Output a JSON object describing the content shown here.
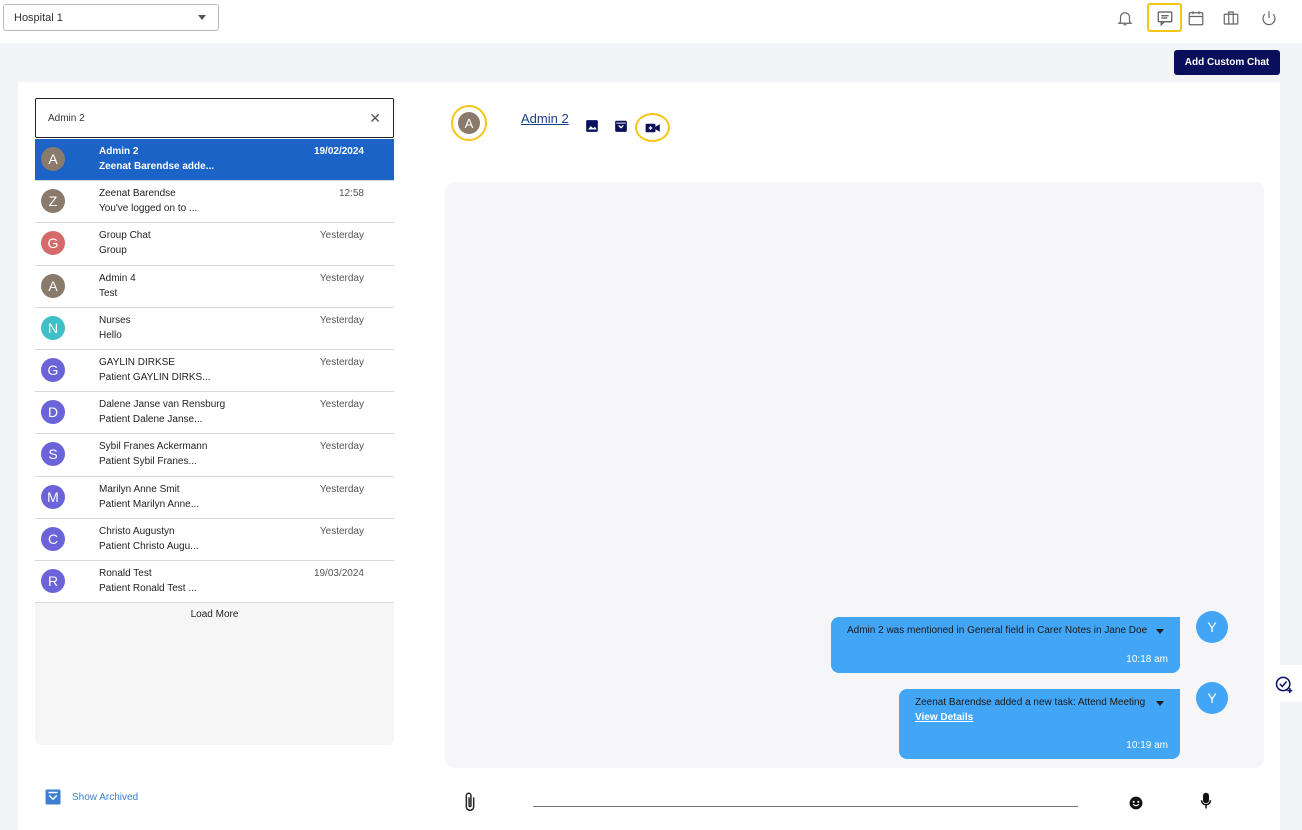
{
  "topbar": {
    "hospital_select": "Hospital 1",
    "icons": [
      "bell-icon",
      "chat-icon",
      "calendar-icon",
      "briefcase-icon",
      "power-icon"
    ]
  },
  "toolbar": {
    "add_custom_chat": "Add Custom Chat"
  },
  "search": {
    "value": "Admin 2"
  },
  "chats": [
    {
      "initial": "A",
      "name": "Admin 2",
      "preview": "Zeenat Barendse adde...",
      "time": "19/02/2024",
      "color": "#8a7a6c",
      "active": true
    },
    {
      "initial": "Z",
      "name": "Zeenat Barendse",
      "preview": "You've logged on to ...",
      "time": "12:58",
      "color": "#8a7a6c"
    },
    {
      "initial": "G",
      "name": "Group Chat",
      "preview": "Group",
      "time": "Yesterday",
      "color": "#d46a6a"
    },
    {
      "initial": "A",
      "name": "Admin 4",
      "preview": "Test",
      "time": "Yesterday",
      "color": "#8a7a6c"
    },
    {
      "initial": "N",
      "name": "Nurses",
      "preview": "Hello",
      "time": "Yesterday",
      "color": "#3fbfc6"
    },
    {
      "initial": "G",
      "name": "GAYLIN DIRKSE",
      "preview": "Patient GAYLIN DIRKS...",
      "time": "Yesterday",
      "color": "#6b63d8"
    },
    {
      "initial": "D",
      "name": "Dalene Janse van Rensburg",
      "preview": "Patient Dalene Janse...",
      "time": "Yesterday",
      "color": "#6b63d8"
    },
    {
      "initial": "S",
      "name": "Sybil Franes Ackermann",
      "preview": "Patient Sybil Franes...",
      "time": "Yesterday",
      "color": "#6b63d8"
    },
    {
      "initial": "M",
      "name": "Marilyn Anne Smit",
      "preview": "Patient Marilyn Anne...",
      "time": "Yesterday",
      "color": "#6b63d8"
    },
    {
      "initial": "C",
      "name": "Christo Augustyn",
      "preview": "Patient Christo Augu...",
      "time": "Yesterday",
      "color": "#6b63d8"
    },
    {
      "initial": "R",
      "name": "Ronald Test",
      "preview": "Patient Ronald Test ...",
      "time": "19/03/2024",
      "color": "#6b63d8"
    }
  ],
  "load_more": "Load More",
  "show_archived": "Show Archived",
  "conversation": {
    "avatar_initial": "A",
    "title": "Admin 2",
    "header_icons": [
      "image-icon",
      "archive-icon",
      "video-call-icon"
    ],
    "messages": [
      {
        "text": "Admin 2 was mentioned in General field in Carer Notes in Jane Doe",
        "time": "10:18 am",
        "avatar": "Y"
      },
      {
        "text": "Zeenat Barendse added a new task: Attend Meeting",
        "link": "View Details",
        "time": "10:19 am",
        "avatar": "Y"
      }
    ]
  },
  "colors": {
    "accent": "#0a0f5c",
    "active_row": "#1b63c6",
    "bubble": "#42a5f5",
    "highlight": "#f5c518"
  }
}
